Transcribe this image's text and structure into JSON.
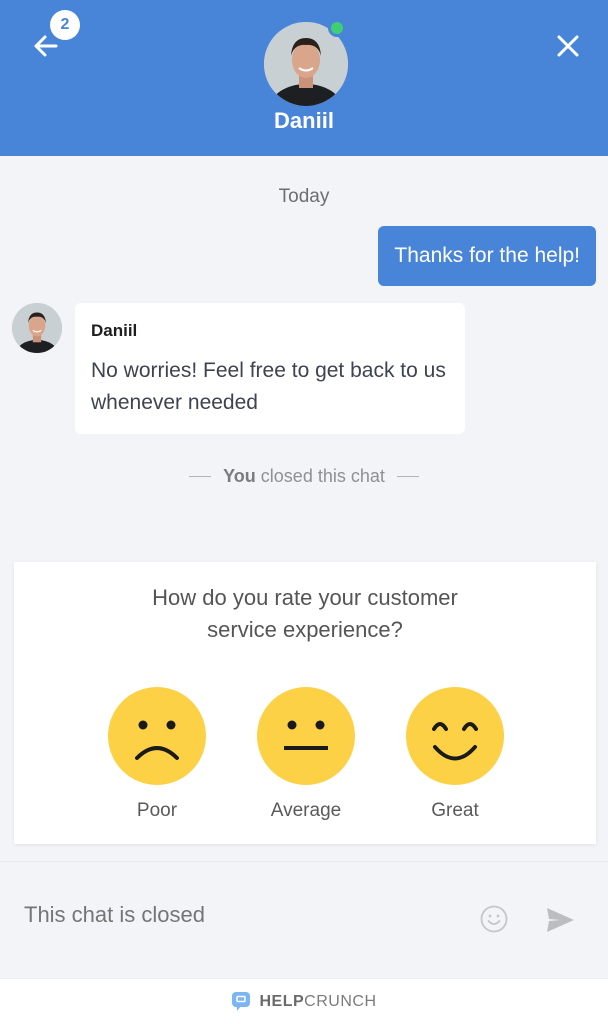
{
  "header": {
    "back_badge_count": "2",
    "agent_name": "Daniil",
    "agent_status": "online",
    "status_color": "#3ecf72",
    "brand_color": "#4885d8"
  },
  "conversation": {
    "date_separator": "Today",
    "messages": [
      {
        "direction": "outgoing",
        "text": "Thanks for the help!"
      },
      {
        "direction": "incoming",
        "sender": "Daniil",
        "text": "No worries! Feel free to get back to us whenever needed"
      }
    ],
    "closed_note": {
      "actor": "You",
      "text": "closed this chat"
    }
  },
  "rating": {
    "question": "How do you rate your customer service experience?",
    "options": [
      {
        "label": "Poor",
        "icon": "sad-face-icon"
      },
      {
        "label": "Average",
        "icon": "neutral-face-icon"
      },
      {
        "label": "Great",
        "icon": "happy-face-icon"
      }
    ],
    "face_color": "#fdd145"
  },
  "composer": {
    "placeholder": "This chat is closed",
    "emoji_icon": "smiley-icon",
    "send_icon": "send-icon"
  },
  "footer": {
    "brand_bold": "HELP",
    "brand_rest": "CRUNCH"
  }
}
